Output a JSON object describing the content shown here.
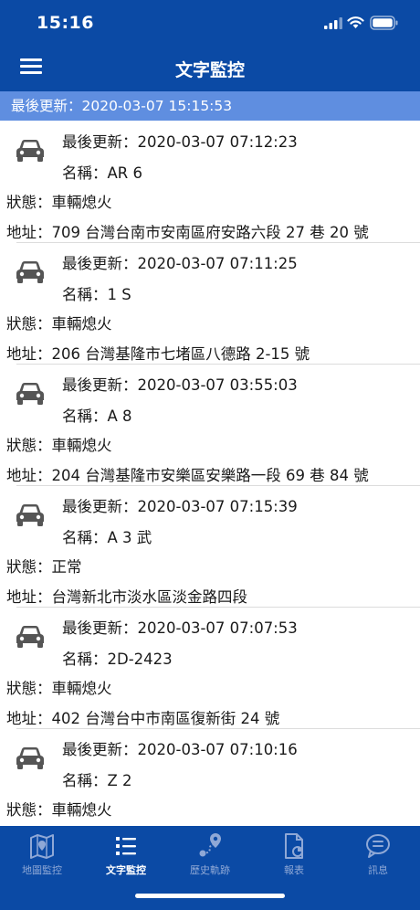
{
  "status_bar": {
    "time": "15:16"
  },
  "header": {
    "title": "文字監控"
  },
  "update_bar": {
    "text": "最後更新：2020-03-07 15:15:53"
  },
  "vehicles": [
    {
      "time": "最後更新：2020-03-07 07:12:23",
      "name": "名稱：AR           6",
      "state": "狀態：車輛熄火",
      "address": "地址：709 台灣台南市安南區府安路六段 27 巷 20 號"
    },
    {
      "time": "最後更新：2020-03-07 07:11:25",
      "name": "名稱：1          S",
      "state": "狀態：車輛熄火",
      "address": "地址：206 台灣基隆市七堵區八德路 2-15 號"
    },
    {
      "time": "最後更新：2020-03-07 03:55:03",
      "name": "名稱：A           8",
      "state": "狀態：車輛熄火",
      "address": "地址：204 台灣基隆市安樂區安樂路一段 69 巷 84 號"
    },
    {
      "time": "最後更新：2020-03-07 07:15:39",
      "name": "名稱：A              3 武",
      "state": "狀態：正常",
      "address": "地址：台灣新北市淡水區淡金路四段"
    },
    {
      "time": "最後更新：2020-03-07 07:07:53",
      "name": "名稱：2D-2423",
      "state": "狀態：車輛熄火",
      "address": "地址：402 台灣台中市南區復新街 24 號"
    },
    {
      "time": "最後更新：2020-03-07 07:10:16",
      "name": "名稱：Z           2",
      "state": "狀態：車輛熄火",
      "address": ""
    }
  ],
  "tabs": [
    {
      "label": "地圖監控",
      "icon": "map-icon"
    },
    {
      "label": "文字監控",
      "icon": "list-icon"
    },
    {
      "label": "歷史軌跡",
      "icon": "route-icon"
    },
    {
      "label": "報表",
      "icon": "report-icon"
    },
    {
      "label": "訊息",
      "icon": "message-icon"
    }
  ],
  "colors": {
    "header": "#0b4aa5",
    "update_bar": "#5f8ee0",
    "tab_inactive": "#8fa8d6",
    "tab_active": "#ffffff"
  }
}
